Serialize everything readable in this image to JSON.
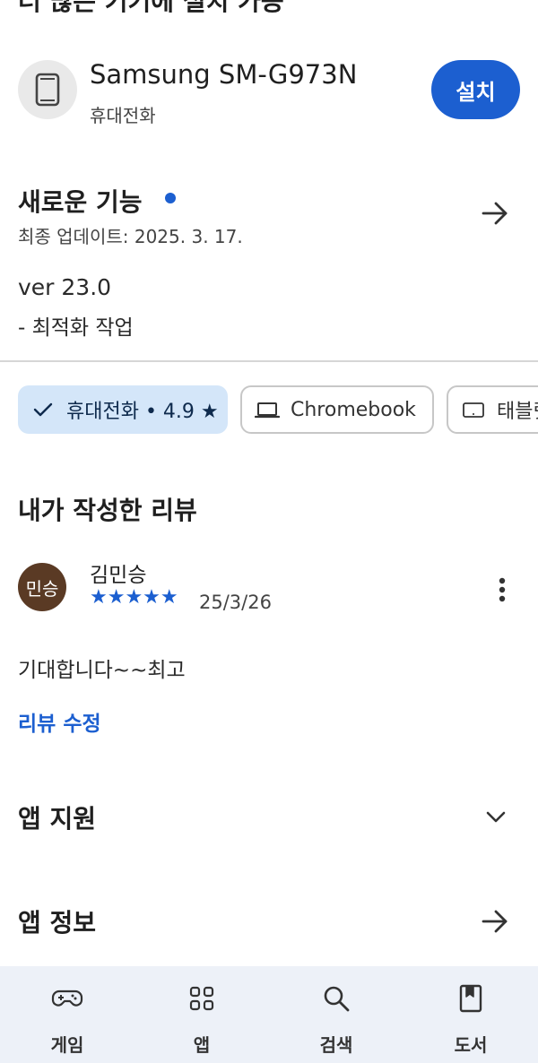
{
  "top_partial": {
    "text": "더 많은 기기에 설치 가능"
  },
  "device": {
    "name": "Samsung SM-G973N",
    "type": "휴대전화",
    "install_label": "설치"
  },
  "whats_new": {
    "title": "새로운 기능",
    "updated": "최종 업데이트: 2025. 3. 17.",
    "notes": [
      "ver 23.0",
      "- 최적화 작업"
    ]
  },
  "device_chips": [
    {
      "label": "휴대전화 • 4.9 ★",
      "selected": true,
      "icon": "check-icon"
    },
    {
      "label": "Chromebook",
      "selected": false,
      "icon": "laptop-icon"
    },
    {
      "label": "태블릿",
      "selected": false,
      "icon": "tablet-icon"
    }
  ],
  "my_review": {
    "title": "내가 작성한 리뷰",
    "reviewer_name": "김민승",
    "avatar_text": "민승",
    "rating": 5,
    "stars": "★★★★★",
    "date": "25/3/26",
    "text": "기대합니다~~최고",
    "edit_label": "리뷰 수정"
  },
  "sections": {
    "app_support": "앱 지원",
    "app_info": "앱 정보"
  },
  "bottom_nav": [
    {
      "label": "게임",
      "icon": "gamepad-icon"
    },
    {
      "label": "앱",
      "icon": "apps-grid-icon"
    },
    {
      "label": "검색",
      "icon": "search-icon"
    },
    {
      "label": "도서",
      "icon": "book-icon"
    }
  ],
  "colors": {
    "accent": "#1c5fd0",
    "chip_selected_bg": "#d4e6f9",
    "avatar_bg": "#5a3a24",
    "nav_bg": "#edf1f8"
  }
}
